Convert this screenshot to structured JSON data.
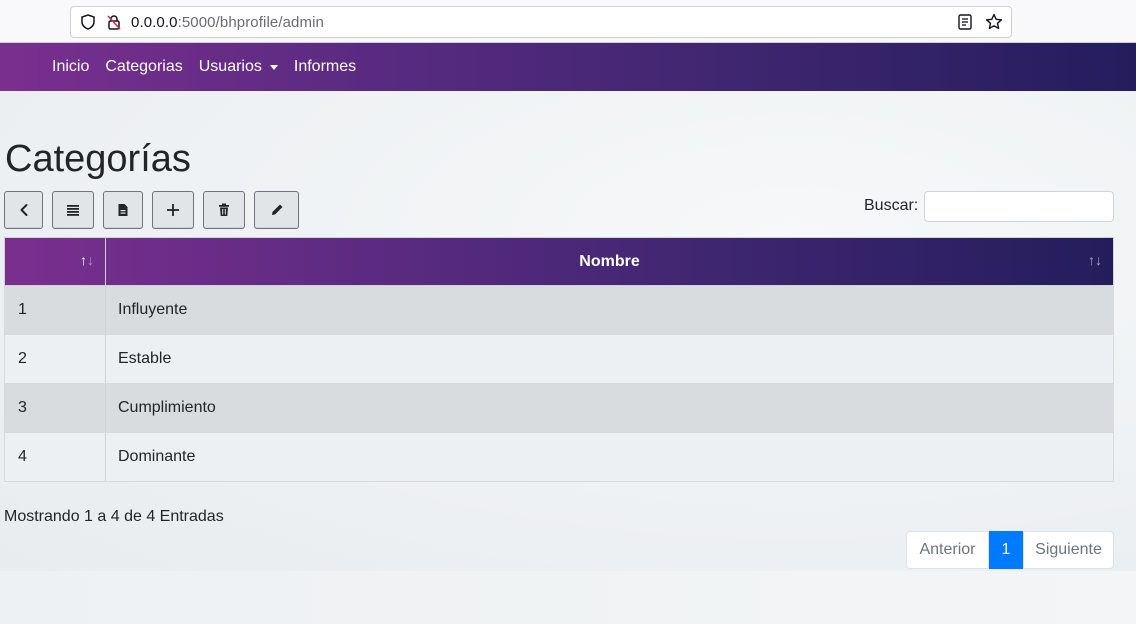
{
  "browser": {
    "url_host": "0.0.0.0",
    "url_path": ":5000/bhprofile/admin"
  },
  "navbar": {
    "items": [
      {
        "label": "Inicio"
      },
      {
        "label": "Categorias"
      },
      {
        "label": "Usuarios"
      },
      {
        "label": "Informes"
      }
    ]
  },
  "page": {
    "title": "Categorías"
  },
  "toolbar": {
    "buttons": [
      "back",
      "list",
      "file",
      "add",
      "delete",
      "edit"
    ]
  },
  "search": {
    "label": "Buscar:",
    "value": "",
    "placeholder": ""
  },
  "table": {
    "headers": [
      "",
      "Nombre"
    ],
    "rows": [
      {
        "id": "1",
        "nombre": "Influyente"
      },
      {
        "id": "2",
        "nombre": "Estable"
      },
      {
        "id": "3",
        "nombre": "Cumplimiento"
      },
      {
        "id": "4",
        "nombre": "Dominante"
      }
    ]
  },
  "info": "Mostrando 1 a 4 de 4 Entradas",
  "pagination": {
    "prev": "Anterior",
    "current": "1",
    "next": "Siguiente"
  },
  "colors": {
    "gradient_start": "#7a2f8f",
    "gradient_end": "#241d5c",
    "pagination_active": "#007bff"
  }
}
